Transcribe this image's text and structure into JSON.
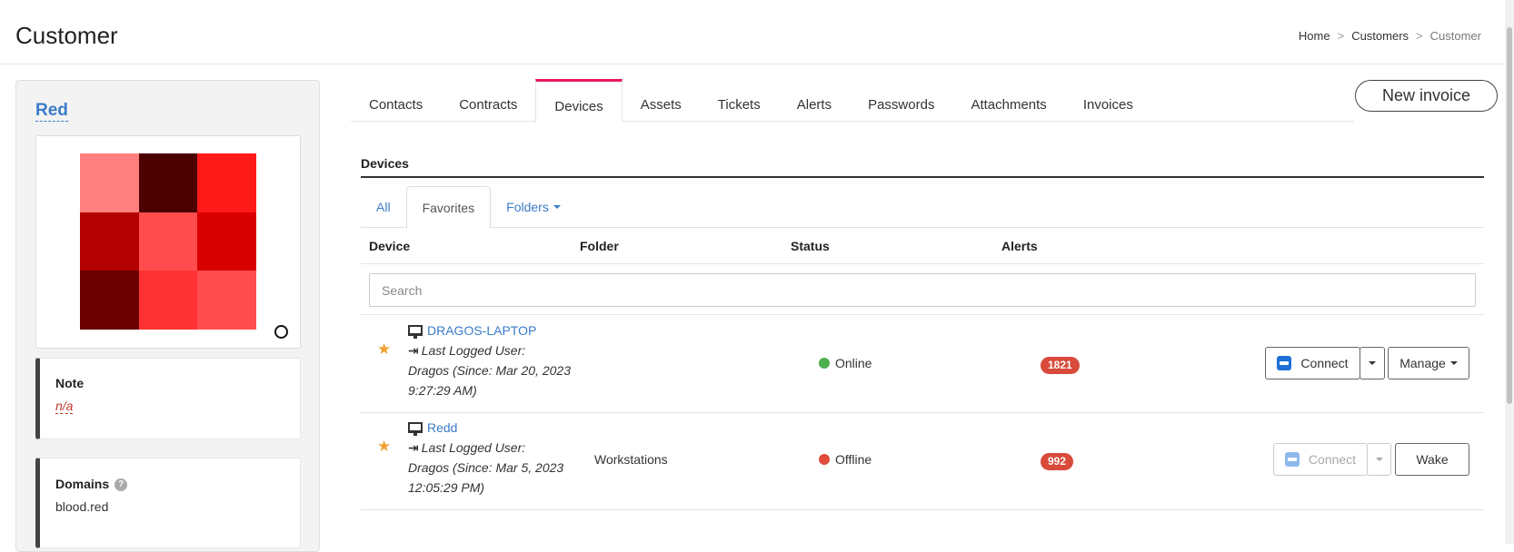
{
  "header": {
    "title": "Customer",
    "breadcrumb": [
      "Home",
      "Customers",
      "Customer"
    ],
    "breadcrumb_sep": ">"
  },
  "customer": {
    "name": "Red",
    "avatar_colors": [
      "#ff7f7f",
      "#4d0000",
      "#ff1a1a",
      "#b30000",
      "#ff4d4d",
      "#d90000",
      "#6b0000",
      "#ff3333",
      "#ff4d4d"
    ],
    "note_label": "Note",
    "note_value": "n/a",
    "domains_label": "Domains",
    "domains_help": "?",
    "domains_value": "blood.red"
  },
  "tabs": [
    "Contacts",
    "Contracts",
    "Devices",
    "Assets",
    "Tickets",
    "Alerts",
    "Passwords",
    "Attachments",
    "Invoices"
  ],
  "active_tab": "Devices",
  "actions": {
    "new_invoice": "New invoice"
  },
  "devices": {
    "section_title": "Devices",
    "subtabs": {
      "all": "All",
      "favorites": "Favorites",
      "folders": "Folders"
    },
    "columns": {
      "device": "Device",
      "folder": "Folder",
      "status": "Status",
      "alerts": "Alerts"
    },
    "search_placeholder": "Search",
    "rows": [
      {
        "name": "DRAGOS-LAPTOP",
        "user_line1": "Last Logged User:",
        "user_line2": "Dragos (Since: Mar 20, 2023",
        "user_line3": "9:27:29 AM)",
        "folder": "",
        "status": "Online",
        "status_color": "#4caf50",
        "alerts": "1821",
        "connect_label": "Connect",
        "second_label": "Manage"
      },
      {
        "name": "Redd",
        "user_line1": "Last Logged User:",
        "user_line2": "Dragos (Since: Mar 5, 2023",
        "user_line3": "12:05:29 PM)",
        "folder": "Workstations",
        "status": "Offline",
        "status_color": "#e04b3c",
        "alerts": "992",
        "connect_label": "Connect",
        "second_label": "Wake"
      }
    ]
  }
}
